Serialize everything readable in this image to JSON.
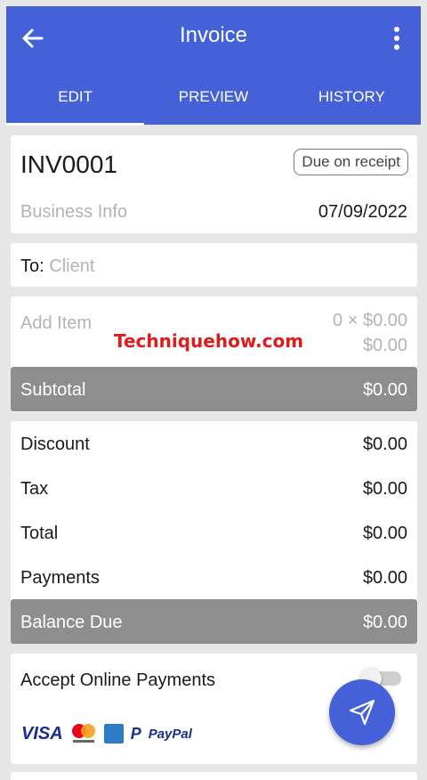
{
  "appbar": {
    "title": "Invoice",
    "tabs": [
      {
        "label": "EDIT",
        "active": true
      },
      {
        "label": "PREVIEW",
        "active": false
      },
      {
        "label": "HISTORY",
        "active": false
      }
    ]
  },
  "invoice": {
    "number": "INV0001",
    "terms": "Due on receipt",
    "business_placeholder": "Business Info",
    "date": "07/09/2022"
  },
  "client": {
    "prefix": "To:",
    "placeholder": "Client"
  },
  "items": {
    "add_label": "Add Item",
    "qty_price": "0 × $0.00",
    "amount": "$0.00"
  },
  "watermark": "Techniquehow.com",
  "subtotal": {
    "label": "Subtotal",
    "value": "$0.00"
  },
  "summary": {
    "discount": {
      "label": "Discount",
      "value": "$0.00"
    },
    "tax": {
      "label": "Tax",
      "value": "$0.00"
    },
    "total": {
      "label": "Total",
      "value": "$0.00"
    },
    "payments": {
      "label": "Payments",
      "value": "$0.00"
    }
  },
  "balance": {
    "label": "Balance Due",
    "value": "$0.00"
  },
  "online": {
    "label": "Accept Online Payments",
    "enabled": false,
    "logos": {
      "visa": "VISA",
      "mastercard": "mastercard",
      "paypal_mark": "P",
      "paypal": "PayPal"
    }
  },
  "colors": {
    "primary": "#4461d8",
    "grey_bar": "#8e8e8e"
  }
}
